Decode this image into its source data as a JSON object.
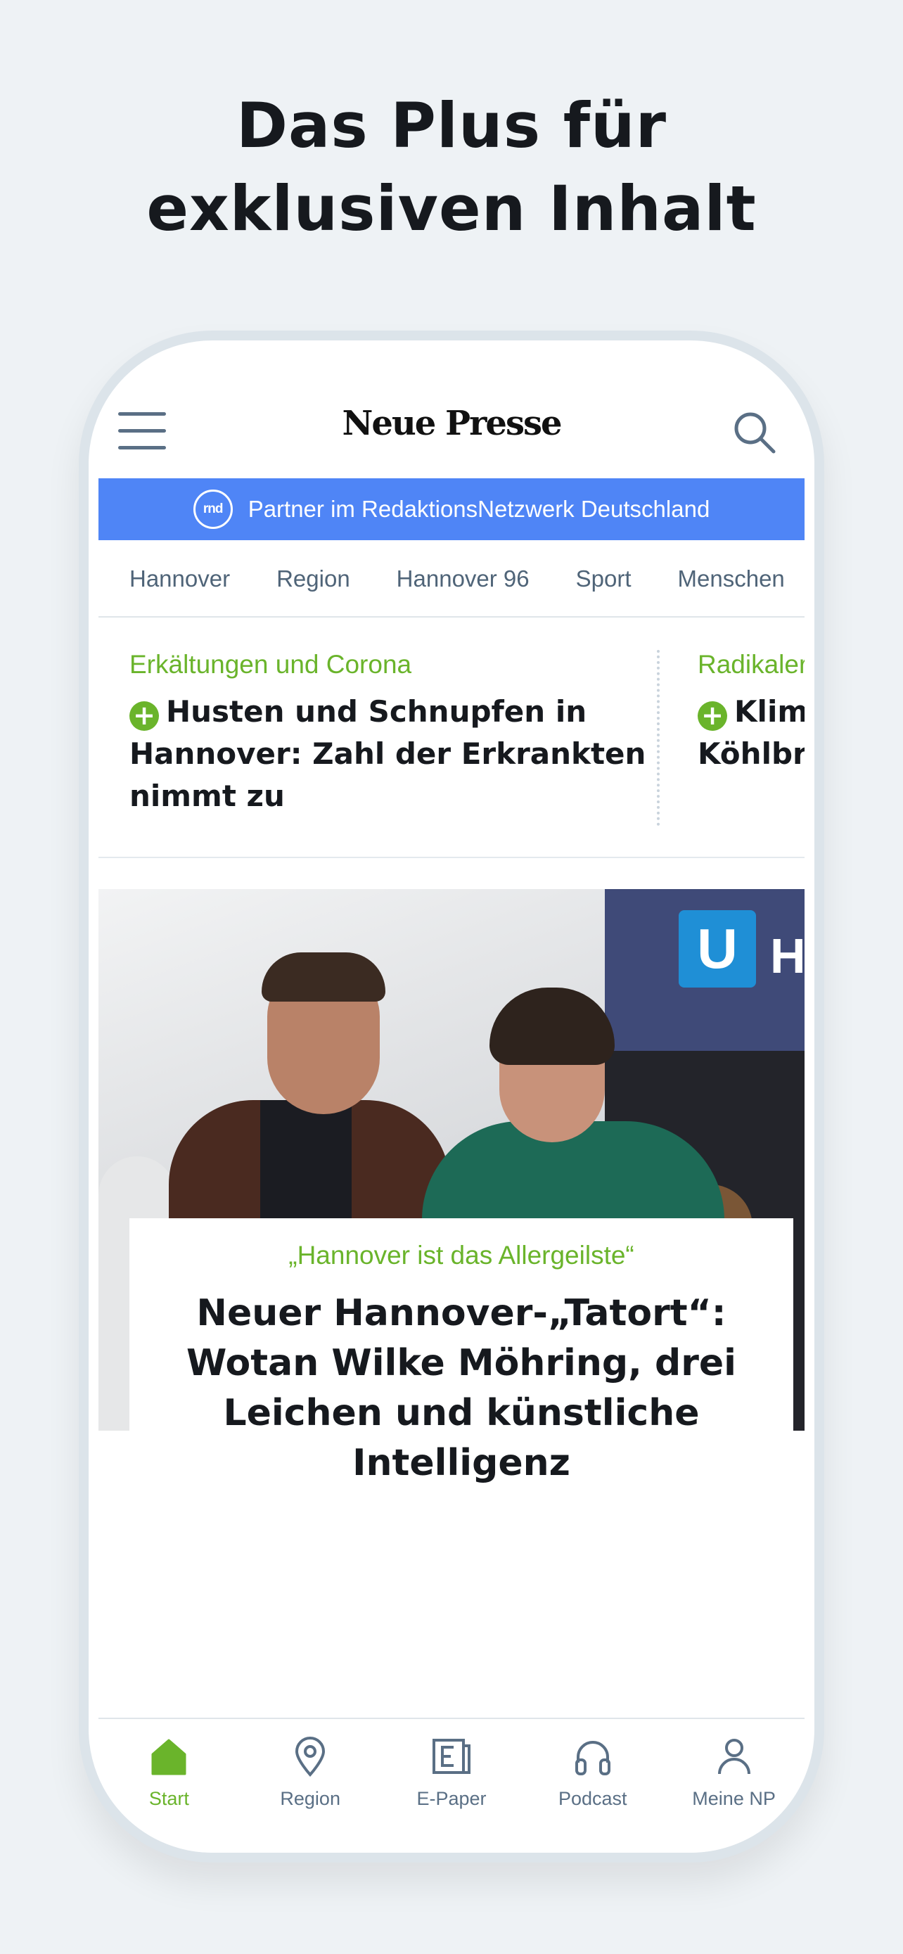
{
  "promo": {
    "headline_line1": "Das Plus für",
    "headline_line2": "exklusiven Inhalt"
  },
  "appbar": {
    "logo": "Neue Presse",
    "menu_icon": "hamburger-icon",
    "search_icon": "search-icon"
  },
  "partner_bar": {
    "logo_text": "rnd",
    "text": "Partner im RedaktionsNetzwerk Deutschland",
    "color": "#4f85f6"
  },
  "tabs": [
    "Hannover",
    "Region",
    "Hannover 96",
    "Sport",
    "Menschen"
  ],
  "teasers": [
    {
      "kicker": "Erkältungen und Corona",
      "title": "Husten und Schnupfen in Hannover: Zahl der Erkrankten nimmt zu",
      "plus": true
    },
    {
      "kicker": "Radikaler",
      "title": "Klima Köhlbrai",
      "plus": true
    }
  ],
  "hero": {
    "sign_letter": "U",
    "sign_text": "H",
    "kicker": "„Hannover ist das Allergeilste“",
    "title": "Neuer Hannover-„Tatort“: Wotan Wilke Möhring, drei Leichen und künstliche Intelligenz"
  },
  "bottom_nav": [
    {
      "label": "Start",
      "icon": "home-icon",
      "active": true
    },
    {
      "label": "Region",
      "icon": "location-pin-icon",
      "active": false
    },
    {
      "label": "E-Paper",
      "icon": "epaper-icon",
      "active": false
    },
    {
      "label": "Podcast",
      "icon": "headphones-icon",
      "active": false
    },
    {
      "label": "Meine NP",
      "icon": "user-icon",
      "active": false
    }
  ],
  "colors": {
    "accent_green": "#6ab42b",
    "nav_grey": "#5a6f85",
    "background": "#eef2f5"
  }
}
